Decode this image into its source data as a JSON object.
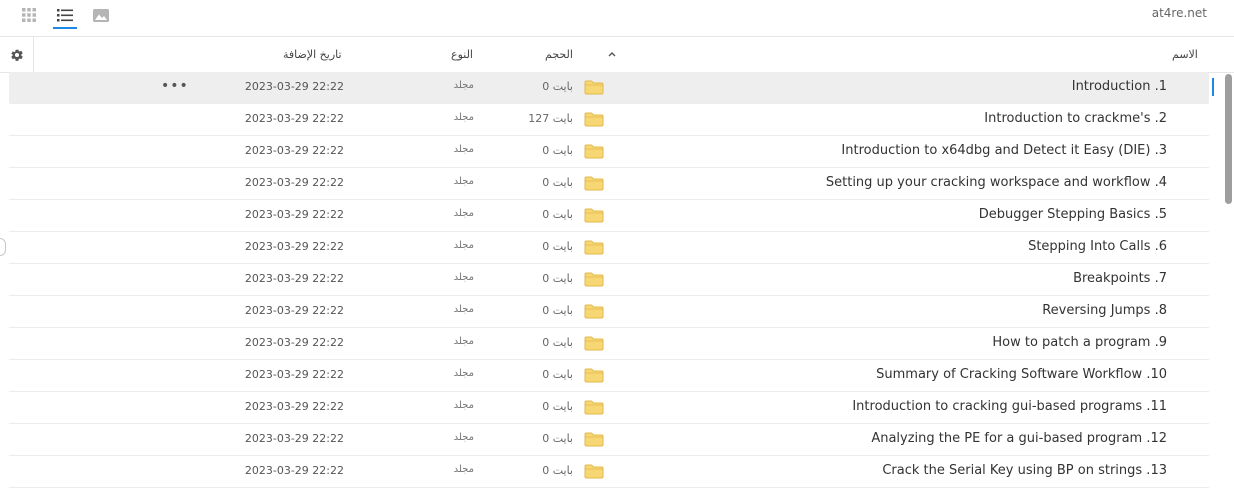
{
  "toolbar": {
    "views": [
      {
        "icon": "grid-icon"
      },
      {
        "icon": "list-icon",
        "active": true
      },
      {
        "icon": "image-icon"
      }
    ],
    "site": "at4re.net"
  },
  "header": {
    "name": "الاسم",
    "size": "الحجم",
    "type": "النوع",
    "date_added": "تاريخ الإضافة",
    "sort_icon": "chevron-up-icon",
    "settings_icon": "gear-icon"
  },
  "rows": [
    {
      "name": "Introduction .1",
      "size": "0 بايت",
      "type": "مجلد",
      "date": "2023-03-29 22:22",
      "selected": true,
      "more": "•••"
    },
    {
      "name": "Introduction to crackme's .2",
      "size": "127 بايت",
      "type": "مجلد",
      "date": "2023-03-29 22:22"
    },
    {
      "name": "Introduction to x64dbg and Detect it Easy (DIE) .3",
      "size": "0 بايت",
      "type": "مجلد",
      "date": "2023-03-29 22:22"
    },
    {
      "name": "Setting up your cracking workspace and workflow .4",
      "size": "0 بايت",
      "type": "مجلد",
      "date": "2023-03-29 22:22"
    },
    {
      "name": "Debugger Stepping Basics .5",
      "size": "0 بايت",
      "type": "مجلد",
      "date": "2023-03-29 22:22"
    },
    {
      "name": "Stepping Into Calls .6",
      "size": "0 بايت",
      "type": "مجلد",
      "date": "2023-03-29 22:22"
    },
    {
      "name": "Breakpoints .7",
      "size": "0 بايت",
      "type": "مجلد",
      "date": "2023-03-29 22:22"
    },
    {
      "name": "Reversing Jumps .8",
      "size": "0 بايت",
      "type": "مجلد",
      "date": "2023-03-29 22:22"
    },
    {
      "name": "How to patch a program .9",
      "size": "0 بايت",
      "type": "مجلد",
      "date": "2023-03-29 22:22"
    },
    {
      "name": "Summary of Cracking Software Workflow .10",
      "size": "0 بايت",
      "type": "مجلد",
      "date": "2023-03-29 22:22"
    },
    {
      "name": "Introduction to cracking gui-based programs .11",
      "size": "0 بايت",
      "type": "مجلد",
      "date": "2023-03-29 22:22"
    },
    {
      "name": "Analyzing the PE for a gui-based program .12",
      "size": "0 بايت",
      "type": "مجلد",
      "date": "2023-03-29 22:22"
    },
    {
      "name": "Crack the Serial Key using BP on strings .13",
      "size": "0 بايت",
      "type": "مجلد",
      "date": "2023-03-29 22:22"
    }
  ],
  "colors": {
    "accent": "#1e88e5",
    "folder": "#f7d774",
    "folder_border": "#e0b94a",
    "selected_bg": "#eeeeee"
  }
}
